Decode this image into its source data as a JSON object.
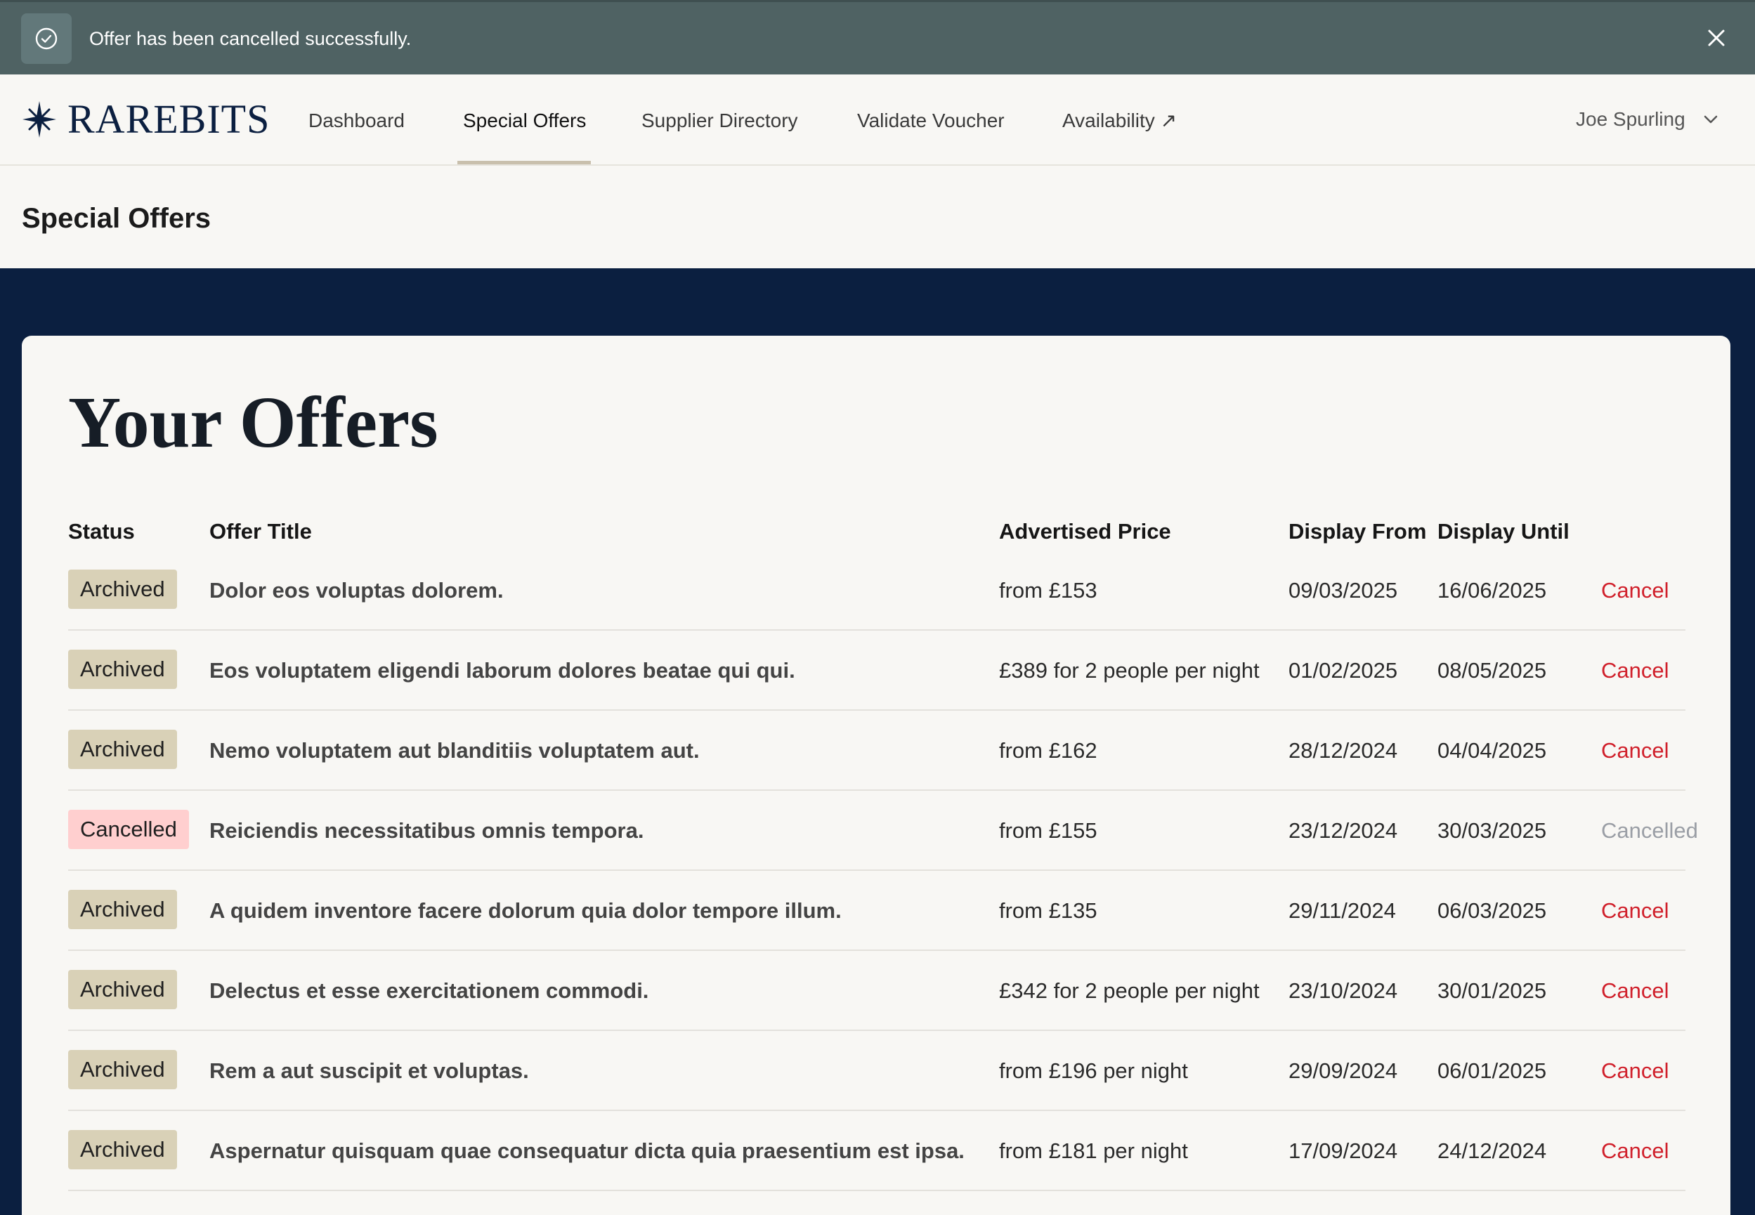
{
  "toast": {
    "message": "Offer has been cancelled successfully.",
    "icon": "check-circle-icon",
    "close_icon": "close-icon"
  },
  "nav": {
    "logo_text": "RAREBITS",
    "logo_icon": "star-compass-icon",
    "links": [
      {
        "label": "Dashboard"
      },
      {
        "label": "Special Offers",
        "active": true
      },
      {
        "label": "Supplier Directory"
      },
      {
        "label": "Validate Voucher"
      },
      {
        "label": "Availability ↗"
      }
    ],
    "user_name": "Joe Spurling",
    "user_menu_icon": "chevron-down-icon"
  },
  "page_title": "Special Offers",
  "offers": {
    "heading": "Your Offers",
    "columns": {
      "status": "Status",
      "title": "Offer Title",
      "price": "Advertised Price",
      "from": "Display From",
      "until": "Display Until"
    },
    "rows": [
      {
        "status": "Archived",
        "title": "Dolor eos voluptas dolorem.",
        "price": "from £153",
        "from": "09/03/2025",
        "until": "16/06/2025",
        "action": "Cancel"
      },
      {
        "status": "Archived",
        "title": "Eos voluptatem eligendi laborum dolores beatae qui qui.",
        "price": "£389 for 2 people per night",
        "from": "01/02/2025",
        "until": "08/05/2025",
        "action": "Cancel"
      },
      {
        "status": "Archived",
        "title": "Nemo voluptatem aut blanditiis voluptatem aut.",
        "price": "from £162",
        "from": "28/12/2024",
        "until": "04/04/2025",
        "action": "Cancel"
      },
      {
        "status": "Cancelled",
        "title": "Reiciendis necessitatibus omnis tempora.",
        "price": "from £155",
        "from": "23/12/2024",
        "until": "30/03/2025",
        "action": "Cancelled"
      },
      {
        "status": "Archived",
        "title": "A quidem inventore facere dolorum quia dolor tempore illum.",
        "price": "from £135",
        "from": "29/11/2024",
        "until": "06/03/2025",
        "action": "Cancel"
      },
      {
        "status": "Archived",
        "title": "Delectus et esse exercitationem commodi.",
        "price": "£342 for 2 people per night",
        "from": "23/10/2024",
        "until": "30/01/2025",
        "action": "Cancel"
      },
      {
        "status": "Archived",
        "title": "Rem a aut suscipit et voluptas.",
        "price": "from £196 per night",
        "from": "29/09/2024",
        "until": "06/01/2025",
        "action": "Cancel"
      },
      {
        "status": "Archived",
        "title": "Aspernatur quisquam quae consequatur dicta quia praesentium est ipsa.",
        "price": "from £181 per night",
        "from": "17/09/2024",
        "until": "24/12/2024",
        "action": "Cancel"
      }
    ]
  },
  "colors": {
    "toast_bg": "#4f6263",
    "navy": "#0b1f40",
    "cancel_red": "#d01f2a",
    "archived_badge": "#d9d1b7",
    "cancelled_badge": "#ffcfcf"
  }
}
